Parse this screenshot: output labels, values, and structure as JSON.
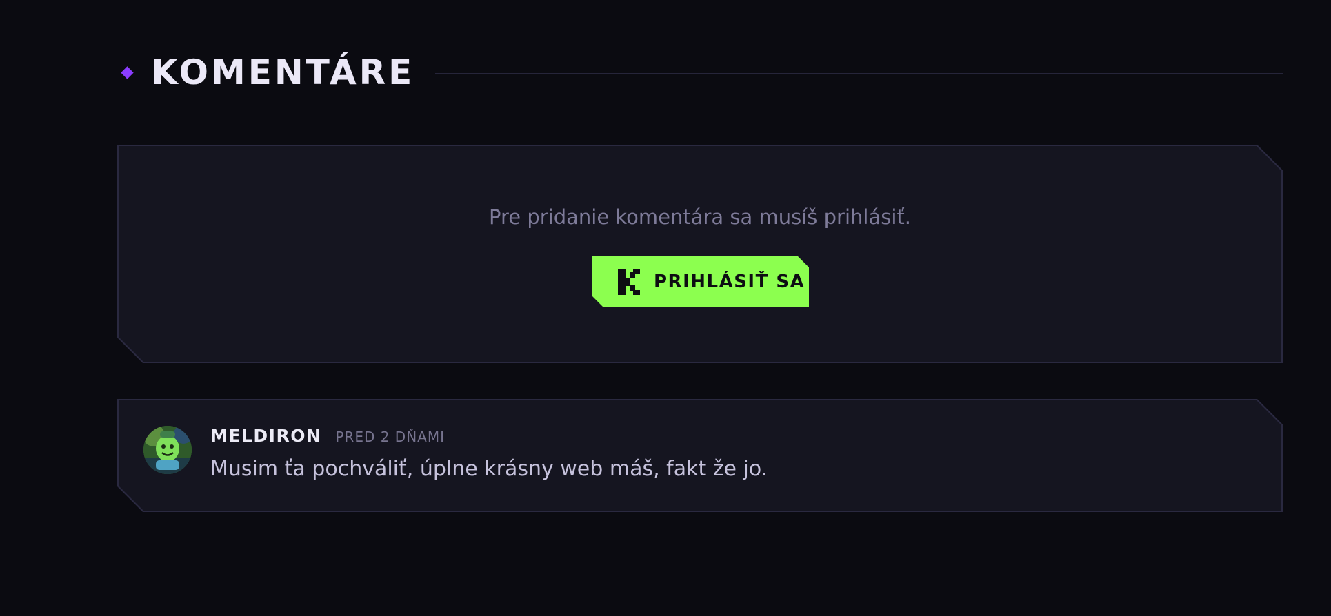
{
  "section": {
    "title": "KOMENTÁRE"
  },
  "login_prompt": {
    "message": "Pre pridanie komentára sa musíš prihlásiť.",
    "button_label": "PRIHLÁSIŤ SA",
    "button_icon": "k-logo-icon"
  },
  "comments": [
    {
      "author": "MELDIRON",
      "time": "PRED 2 DŇAMI",
      "text": "Musim ťa pochváliť, úplne krásny web máš, fakt že jo.",
      "avatar": "green-character-avatar"
    }
  ],
  "colors": {
    "background": "#0b0b11",
    "panel": "#151520",
    "panel_border": "#2a2940",
    "accent_purple": "#8b3dff",
    "accent_green": "#8cff4f"
  }
}
